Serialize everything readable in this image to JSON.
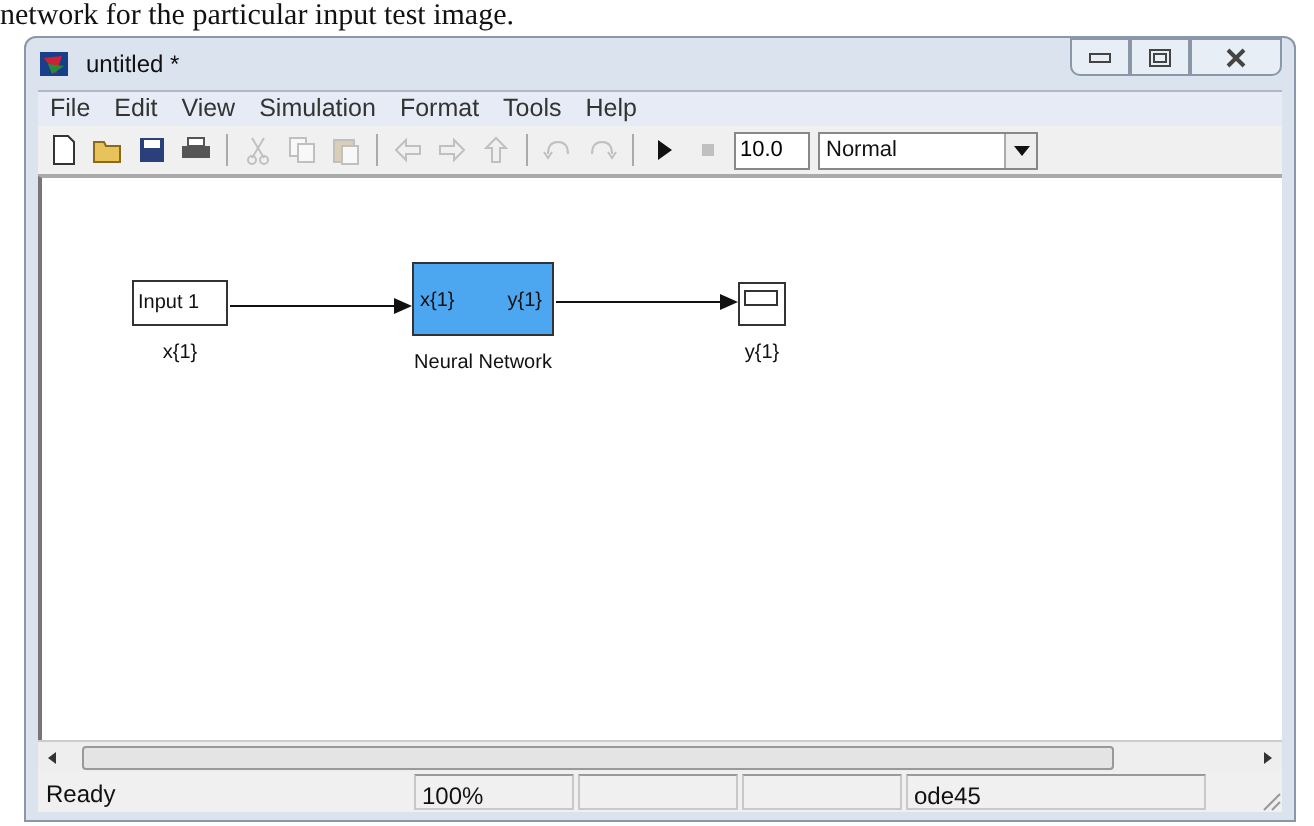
{
  "caption": "network for the particular input test image.",
  "window": {
    "title": "untitled *"
  },
  "menu": [
    "File",
    "Edit",
    "View",
    "Simulation",
    "Format",
    "Tools",
    "Help"
  ],
  "toolbar": {
    "buttons": [
      {
        "disabled": false
      },
      {
        "disabled": false
      },
      {
        "disabled": false
      },
      {
        "disabled": false
      },
      {
        "disabled": true
      },
      {
        "disabled": true
      },
      {
        "disabled": true
      },
      {
        "disabled": true
      },
      {
        "disabled": true
      },
      {
        "disabled": true
      },
      {
        "disabled": true
      },
      {
        "disabled": true
      },
      {
        "disabled": false
      },
      {
        "disabled": true
      }
    ],
    "stop_time": "10.0",
    "mode": "Normal"
  },
  "diagram": {
    "blocks": [
      {
        "kind": "inport",
        "label": "Input 1",
        "caption": "x{1}"
      },
      {
        "kind": "network",
        "caption": "Neural Network",
        "input_port": "x{1}",
        "output_port": "y{1}"
      },
      {
        "kind": "scope",
        "caption": "y{1}"
      }
    ]
  },
  "status_bar": [
    "Ready",
    "100%",
    "ode45"
  ]
}
